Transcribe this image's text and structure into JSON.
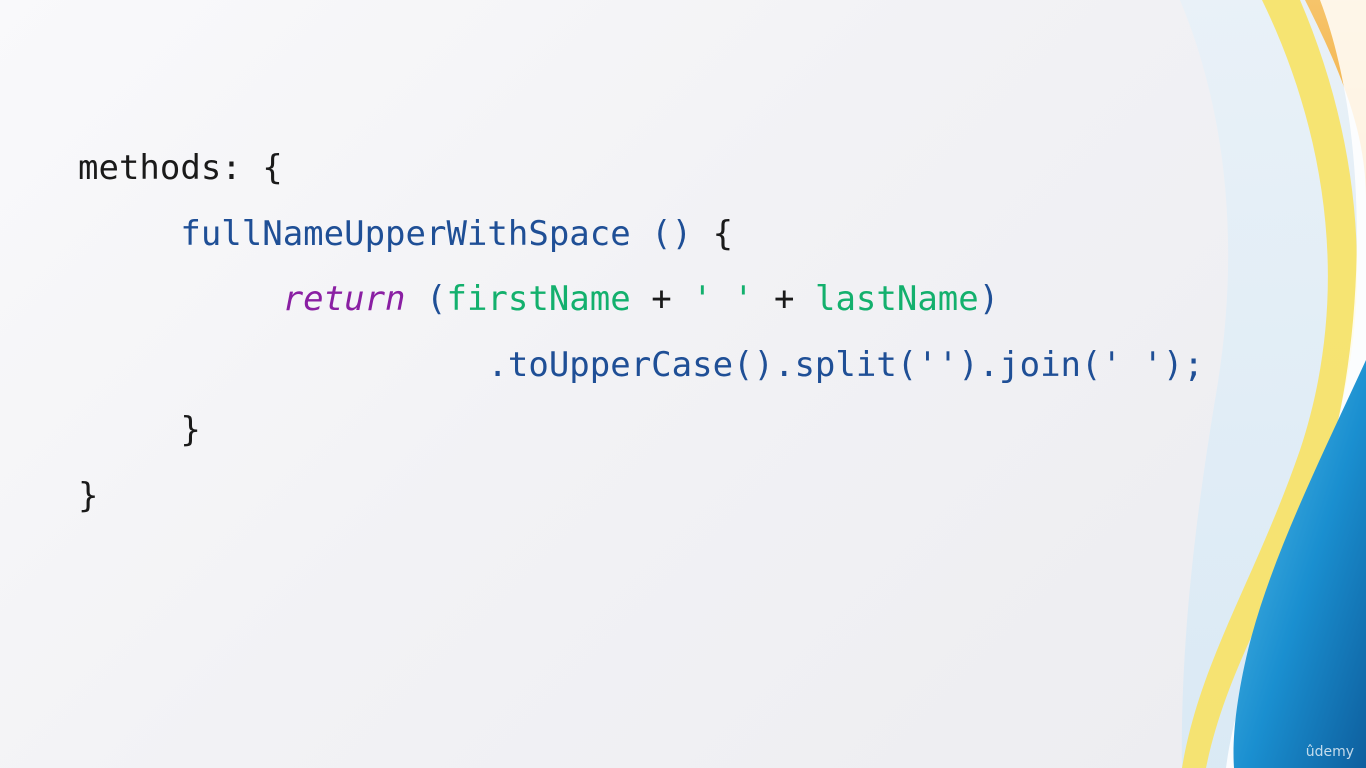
{
  "colors": {
    "background": "#f2f2f5",
    "plain": "#1a1a1a",
    "function": "#1f4f96",
    "keyword": "#8a1fa3",
    "variable": "#13b06d",
    "accent_blue": "#1a8fd0",
    "accent_yellow": "#f7e36a",
    "accent_orange": "#f2b54a"
  },
  "code": {
    "l1_text": "methods: {",
    "l2_indent": "     ",
    "l2_func": "fullNameUpperWithSpace ()",
    "l2_brace": " {",
    "l3_indent": "          ",
    "l3_kw": "return",
    "l3_open": " (",
    "l3_first": "firstName",
    "l3_plus1": " + ",
    "l3_str": "' '",
    "l3_plus2": " + ",
    "l3_last": "lastName",
    "l3_close": ")",
    "l4_indent": "                    ",
    "l4_chain": ".toUpperCase().split('').join(' ');",
    "l5_indent": "     ",
    "l5_text": "}",
    "l6_text": "}"
  },
  "watermark": "ûdemy"
}
